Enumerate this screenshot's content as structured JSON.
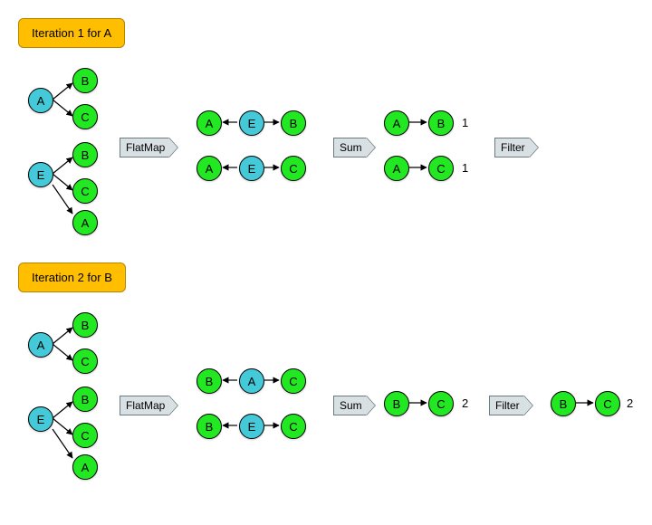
{
  "colors": {
    "blue_node": "#44c9d8",
    "green_node": "#21e821",
    "badge": "#ffbf00",
    "tag": "#d9e0e3"
  },
  "iter1": {
    "title": "Iteration 1 for A",
    "ops": {
      "flatmap": "FlatMap",
      "sum": "Sum",
      "filter": "Filter"
    },
    "input_trees": [
      {
        "root": "A",
        "children": [
          "B",
          "C"
        ]
      },
      {
        "root": "E",
        "children": [
          "B",
          "C",
          "A"
        ]
      }
    ],
    "flatmap_out": [
      {
        "left": "A",
        "mid": "E",
        "right": "B"
      },
      {
        "left": "A",
        "mid": "E",
        "right": "C"
      }
    ],
    "sum_out": [
      {
        "left": "A",
        "right": "B",
        "count": "1"
      },
      {
        "left": "A",
        "right": "C",
        "count": "1"
      }
    ],
    "filter_out": []
  },
  "iter2": {
    "title": "Iteration 2 for B",
    "ops": {
      "flatmap": "FlatMap",
      "sum": "Sum",
      "filter": "Filter"
    },
    "input_trees": [
      {
        "root": "A",
        "children": [
          "B",
          "C"
        ]
      },
      {
        "root": "E",
        "children": [
          "B",
          "C",
          "A"
        ]
      }
    ],
    "flatmap_out": [
      {
        "left": "B",
        "mid": "A",
        "right": "C"
      },
      {
        "left": "B",
        "mid": "E",
        "right": "C"
      }
    ],
    "sum_out": [
      {
        "left": "B",
        "right": "C",
        "count": "2"
      }
    ],
    "filter_out": [
      {
        "left": "B",
        "right": "C",
        "count": "2"
      }
    ]
  }
}
